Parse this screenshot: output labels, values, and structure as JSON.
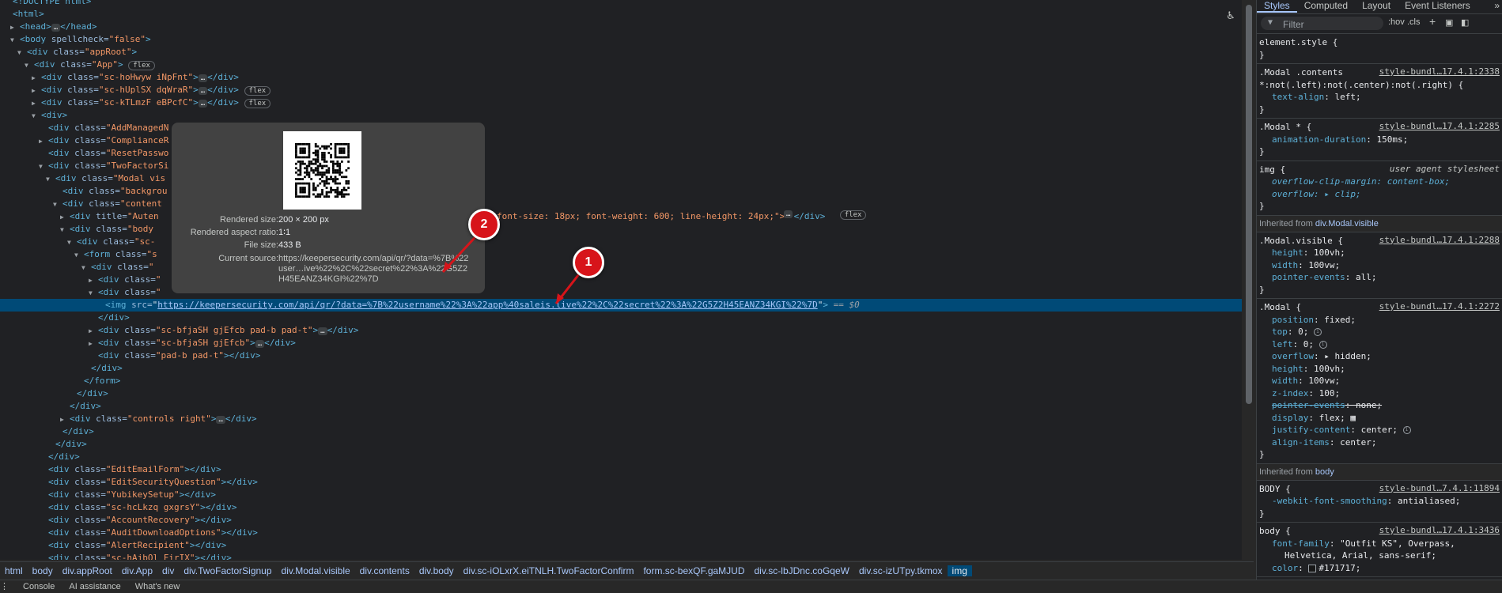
{
  "elements_panel": {
    "lines": [
      {
        "indent": 0,
        "arrow": "",
        "html": "&lt;!DOCTYPE html&gt;"
      },
      {
        "indent": 0,
        "arrow": "",
        "tag": "html"
      },
      {
        "indent": 1,
        "arrow": "right",
        "tag": "head",
        "collapsed": true,
        "close": "head"
      },
      {
        "indent": 1,
        "arrow": "down",
        "tag": "body",
        "attrs": [
          [
            "spellcheck",
            "false"
          ]
        ]
      },
      {
        "indent": 2,
        "arrow": "down",
        "tag": "div",
        "attrs": [
          [
            "class",
            "appRoot"
          ]
        ]
      },
      {
        "indent": 3,
        "arrow": "down",
        "tag": "div",
        "attrs": [
          [
            "class",
            "App"
          ]
        ],
        "badge": "flex"
      },
      {
        "indent": 4,
        "arrow": "right",
        "tag": "div",
        "attrs": [
          [
            "class",
            "sc-hoHwyw iNpFnt"
          ]
        ],
        "collapsed": true,
        "close": "div"
      },
      {
        "indent": 4,
        "arrow": "right",
        "tag": "div",
        "attrs": [
          [
            "class",
            "sc-hUplSX dqWraR"
          ]
        ],
        "collapsed": true,
        "close": "div",
        "badge": "flex"
      },
      {
        "indent": 4,
        "arrow": "right",
        "tag": "div",
        "attrs": [
          [
            "class",
            "sc-kTLmzF eBPcfC"
          ]
        ],
        "collapsed": true,
        "close": "div",
        "badge": "flex"
      },
      {
        "indent": 4,
        "arrow": "down",
        "tag": "div"
      },
      {
        "indent": 5,
        "arrow": "",
        "tag": "div",
        "attrs": [
          [
            "class",
            "AddManagedN"
          ]
        ],
        "cut": true
      },
      {
        "indent": 5,
        "arrow": "right",
        "tag": "div",
        "attrs": [
          [
            "class",
            "ComplianceR"
          ]
        ],
        "cut": true
      },
      {
        "indent": 5,
        "arrow": "",
        "tag": "div",
        "attrs": [
          [
            "class",
            "ResetPasswo"
          ]
        ],
        "cut": true
      },
      {
        "indent": 5,
        "arrow": "down",
        "tag": "div",
        "attrs": [
          [
            "class",
            "TwoFactorSi"
          ]
        ],
        "cut": true
      },
      {
        "indent": 6,
        "arrow": "down",
        "tag": "div",
        "attrs": [
          [
            "class",
            "Modal vis"
          ]
        ],
        "cut": true
      },
      {
        "indent": 7,
        "arrow": "",
        "tag": "div",
        "attrs": [
          [
            "class",
            "backgrou"
          ]
        ],
        "cut": true
      },
      {
        "indent": 7,
        "arrow": "down",
        "tag": "div",
        "attrs": [
          [
            "class",
            "content"
          ]
        ],
        "cut": true
      },
      {
        "indent": 8,
        "arrow": "right",
        "tag": "div",
        "attrs": [
          [
            "title",
            "Auten"
          ]
        ],
        "cut": true,
        "tail": "font-size: 18px; font-weight: 600; line-height: 24px;\">",
        "tail_collapsed": true,
        "badge": "flex"
      },
      {
        "indent": 8,
        "arrow": "down",
        "tag": "div",
        "attrs": [
          [
            "class",
            "body"
          ]
        ],
        "cut": true
      },
      {
        "indent": 9,
        "arrow": "down",
        "tag": "div",
        "attrs": [
          [
            "class",
            "sc-"
          ]
        ],
        "cut": true
      },
      {
        "indent": 10,
        "arrow": "down",
        "tag": "form",
        "attrs": [
          [
            "class",
            "s"
          ]
        ],
        "cut": true
      },
      {
        "indent": 11,
        "arrow": "down",
        "tag": "div",
        "attrs": [
          [
            "class",
            ""
          ]
        ],
        "cut": true
      },
      {
        "indent": 12,
        "arrow": "right",
        "tag": "div",
        "attrs": [
          [
            "class",
            ""
          ]
        ],
        "cut": true
      },
      {
        "indent": 12,
        "arrow": "down",
        "tag": "div",
        "attrs": [
          [
            "class",
            ""
          ]
        ],
        "cut": true
      },
      {
        "indent": 13,
        "arrow": "",
        "tag": "img",
        "selected": true,
        "src": "https://keepersecurity.com/api/qr/?data=%7B%22username%22%3A%22app%40saleis.live%22%2C%22secret%22%3A%22G5Z2H45EANZ34KGI%22%7D",
        "eq": "== $0"
      },
      {
        "indent": 12,
        "arrow": "",
        "closetag": "div"
      },
      {
        "indent": 12,
        "arrow": "right",
        "tag": "div",
        "attrs": [
          [
            "class",
            "sc-bfjaSH gjEfcb pad-b pad-t"
          ]
        ],
        "collapsed": true,
        "close": "div"
      },
      {
        "indent": 12,
        "arrow": "right",
        "tag": "div",
        "attrs": [
          [
            "class",
            "sc-bfjaSH gjEfcb"
          ]
        ],
        "collapsed": true,
        "close": "div"
      },
      {
        "indent": 12,
        "arrow": "",
        "tag": "div",
        "attrs": [
          [
            "class",
            "pad-b pad-t"
          ]
        ],
        "close": "div"
      },
      {
        "indent": 11,
        "arrow": "",
        "closetag": "div"
      },
      {
        "indent": 10,
        "arrow": "",
        "closetag": "form"
      },
      {
        "indent": 9,
        "arrow": "",
        "closetag": "div"
      },
      {
        "indent": 8,
        "arrow": "",
        "closetag": "div"
      },
      {
        "indent": 8,
        "arrow": "right",
        "tag": "div",
        "attrs": [
          [
            "class",
            "controls right"
          ]
        ],
        "collapsed": true,
        "close": "div"
      },
      {
        "indent": 7,
        "arrow": "",
        "closetag": "div"
      },
      {
        "indent": 6,
        "arrow": "",
        "closetag": "div"
      },
      {
        "indent": 5,
        "arrow": "",
        "closetag": "div"
      },
      {
        "indent": 5,
        "arrow": "",
        "tag": "div",
        "attrs": [
          [
            "class",
            "EditEmailForm"
          ]
        ],
        "close": "div"
      },
      {
        "indent": 5,
        "arrow": "",
        "tag": "div",
        "attrs": [
          [
            "class",
            "EditSecurityQuestion"
          ]
        ],
        "close": "div"
      },
      {
        "indent": 5,
        "arrow": "",
        "tag": "div",
        "attrs": [
          [
            "class",
            "YubikeySetup"
          ]
        ],
        "close": "div"
      },
      {
        "indent": 5,
        "arrow": "",
        "tag": "div",
        "attrs": [
          [
            "class",
            "sc-hcLkzq gxgrsY"
          ]
        ],
        "close": "div"
      },
      {
        "indent": 5,
        "arrow": "",
        "tag": "div",
        "attrs": [
          [
            "class",
            "AccountRecovery"
          ]
        ],
        "close": "div"
      },
      {
        "indent": 5,
        "arrow": "",
        "tag": "div",
        "attrs": [
          [
            "class",
            "AuditDownloadOptions"
          ]
        ],
        "close": "div"
      },
      {
        "indent": 5,
        "arrow": "",
        "tag": "div",
        "attrs": [
          [
            "class",
            "AlertRecipient"
          ]
        ],
        "close": "div"
      },
      {
        "indent": 5,
        "arrow": "",
        "tag": "div",
        "attrs": [
          [
            "class",
            "sc-hAjbQl FirIX"
          ]
        ],
        "close": "div"
      }
    ]
  },
  "tooltip": {
    "rendered_size_label": "Rendered size:",
    "rendered_size_value": "200 × 200 px",
    "aspect_label": "Rendered aspect ratio:",
    "aspect_value": "1∶1",
    "file_size_label": "File size:",
    "file_size_value": "433 B",
    "source_label": "Current source:",
    "source_value": "https://keepersecurity.com/api/qr/?data=%7B%22user…ive%22%2C%22secret%22%3A%22G5Z2H45EANZ34KGI%22%7D"
  },
  "annotations": [
    {
      "number": "1"
    },
    {
      "number": "2"
    }
  ],
  "breadcrumbs": [
    "html",
    "body",
    "div.appRoot",
    "div.App",
    "div",
    "div.TwoFactorSignup",
    "div.Modal.visible",
    "div.contents",
    "div.body",
    "div.sc-iOLxrX.eiTNLH.TwoFactorConfirm",
    "form.sc-bexQF.gaMJUD",
    "div.sc-lbJDnc.coGqeW",
    "div.sc-izUTpy.tkmox",
    "img"
  ],
  "drawer_tabs": [
    "Console",
    "AI assistance",
    "What's new"
  ],
  "styles_panel": {
    "tabs": [
      "Styles",
      "Computed",
      "Layout",
      "Event Listeners"
    ],
    "filter_placeholder": "Filter",
    "hov": ":hov",
    "cls": ".cls",
    "rules": [
      {
        "selector": "element.style {",
        "props": [],
        "end": "}"
      },
      {
        "selector": ".Modal .contents *:not(.left):not(.center):not(.right) {",
        "selector_lines": [
          ".Modal .contents",
          "*:not(.left):not(.center):not(.right) {"
        ],
        "source": "style-bundl…17.4.1:2338",
        "props": [
          [
            "text-align",
            "left;"
          ]
        ],
        "end": "}"
      },
      {
        "selector": ".Modal * {",
        "source": "style-bundl…17.4.1:2285",
        "props": [
          [
            "animation-duration",
            "150ms;"
          ]
        ],
        "end": "}"
      },
      {
        "selector": "img {",
        "source": "user agent stylesheet",
        "ua": true,
        "props": [
          [
            "overflow-clip-margin",
            "content-box;"
          ],
          [
            "overflow",
            "▸ clip;"
          ]
        ],
        "end": "}"
      }
    ],
    "inherited_modal": "Inherited from",
    "inherited_modal_sel": "div.Modal.visible",
    "rules2": [
      {
        "selector": ".Modal.visible {",
        "source": "style-bundl…17.4.1:2288",
        "props": [
          [
            "height",
            "100vh;"
          ],
          [
            "width",
            "100vw;"
          ],
          [
            "pointer-events",
            "all;"
          ]
        ],
        "end": "}"
      },
      {
        "selector": ".Modal {",
        "source": "style-bundl…17.4.1:2272",
        "props": [
          [
            "position",
            "fixed;"
          ],
          [
            "top",
            "0;"
          ],
          [
            "left",
            "0;"
          ],
          [
            "overflow",
            "▸ hidden;"
          ],
          [
            "height",
            "100vh;"
          ],
          [
            "width",
            "100vw;"
          ],
          [
            "z-index",
            "100;"
          ],
          [
            "pointer-events",
            "none;"
          ],
          [
            "display",
            "flex;"
          ],
          [
            "justify-content",
            "center;"
          ],
          [
            "align-items",
            "center;"
          ]
        ],
        "struck": [
          "pointer-events"
        ],
        "end": "}"
      }
    ],
    "inherited_body": "Inherited from",
    "inherited_body_sel": "body",
    "rules3": [
      {
        "selector": "BODY {",
        "source": "style-bundl…7.4.1:11894",
        "props": [
          [
            "-webkit-font-smoothing",
            "antialiased;"
          ]
        ],
        "end": "}"
      },
      {
        "selector": "body {",
        "source": "style-bundl…17.4.1:3436",
        "props": [
          [
            "font-family",
            "\"Outfit KS\", Overpass,"
          ],
          [
            "",
            "Helvetica, Arial, sans-serif;"
          ],
          [
            "color",
            "#171717;"
          ]
        ],
        "end": ""
      }
    ]
  },
  "colors": {
    "selected_row": "#004a77",
    "marker": "#d7141a",
    "link": "#a8c7fa"
  }
}
